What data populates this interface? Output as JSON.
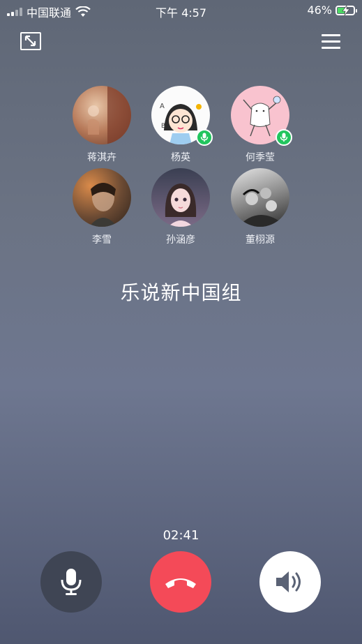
{
  "status_bar": {
    "carrier": "中国联通",
    "time": "下午 4:57",
    "battery_percent_text": "46%",
    "battery_level": 0.46
  },
  "top_bar": {
    "minimize_icon": "minimize-window-icon",
    "menu_icon": "hamburger-menu-icon"
  },
  "participants": [
    {
      "name": "蒋淇卉",
      "speaking": false
    },
    {
      "name": "杨英",
      "speaking": true
    },
    {
      "name": "何季莹",
      "speaking": true
    },
    {
      "name": "李雪",
      "speaking": false
    },
    {
      "name": "孙涵彦",
      "speaking": false
    },
    {
      "name": "董栩源",
      "speaking": false
    }
  ],
  "group_name": "乐说新中国组",
  "call_duration": "02:41",
  "controls": {
    "mute_icon": "microphone-icon",
    "hangup_icon": "phone-hangup-icon",
    "speaker_icon": "speaker-icon"
  },
  "colors": {
    "speaking_badge": "#22c55e",
    "hangup": "#f44a58",
    "mute_bg": "#3f4554",
    "speaker_bg": "#ffffff"
  }
}
